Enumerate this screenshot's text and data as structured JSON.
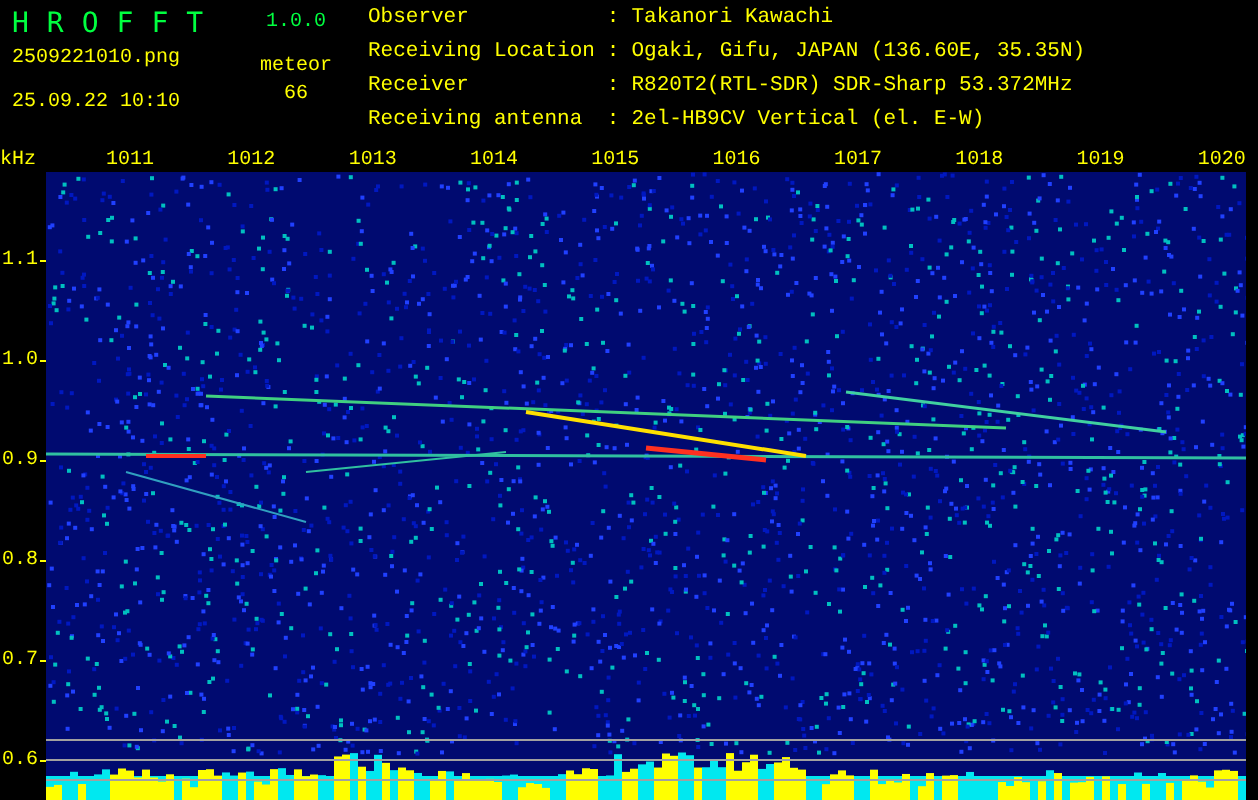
{
  "app": {
    "name": "HROFFT",
    "version": "1.0.0"
  },
  "file": "2509221010.png",
  "timestamp": "25.09.22 10:10",
  "count_label": "meteor",
  "count": "66",
  "info": [
    {
      "label": "Observer",
      "separator": ":",
      "value": "Takanori Kawachi"
    },
    {
      "label": "Receiving Location",
      "separator": ":",
      "value": "Ogaki, Gifu, JAPAN (136.60E, 35.35N)"
    },
    {
      "label": "Receiver",
      "separator": ":",
      "value": "R820T2(RTL-SDR) SDR-Sharp 53.372MHz"
    },
    {
      "label": "Receiving antenna",
      "separator": ":",
      "value": "2el-HB9CV Vertical (el. E-W)"
    }
  ],
  "plot": {
    "y_unit": "kHz",
    "x_ticks": [
      "1011",
      "1012",
      "1013",
      "1014",
      "1015",
      "1016",
      "1017",
      "1018",
      "1019",
      "1020"
    ],
    "y_ticks": [
      "1.1",
      "1.0",
      "0.9",
      "0.8",
      "0.7",
      "0.6"
    ]
  }
}
